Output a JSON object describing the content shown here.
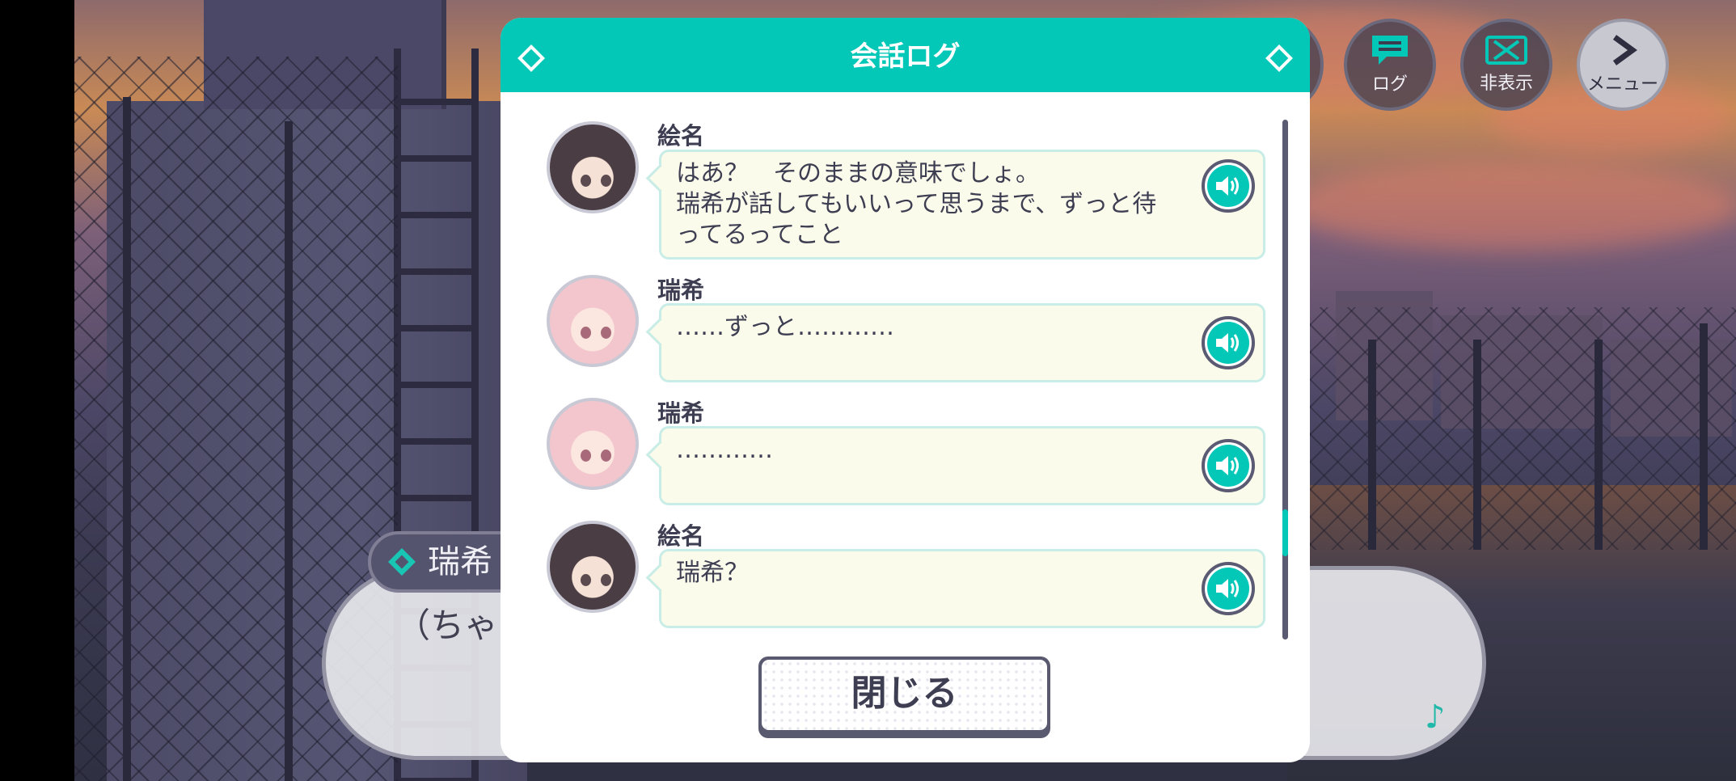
{
  "top_buttons": {
    "log": "ログ",
    "hide": "非表示",
    "menu": "メニュー"
  },
  "dialogue": {
    "speaker": "瑞希",
    "text": "（ちゃん"
  },
  "log_dialog": {
    "title": "会話ログ",
    "entries": [
      {
        "speaker": "絵名",
        "text": "はあ？　そのままの意味でしょ。\n瑞希が話してもいいって思うまで、ずっと待\nってるってこと"
      },
      {
        "speaker": "瑞希",
        "text": "……ずっと…………"
      },
      {
        "speaker": "瑞希",
        "text": "…………"
      },
      {
        "speaker": "絵名",
        "text": "瑞希？"
      }
    ],
    "close_label": "閉じる"
  },
  "colors": {
    "accent": "#03c8b8",
    "bubble_bg": "#fbfbec",
    "text": "#3e3e52"
  }
}
